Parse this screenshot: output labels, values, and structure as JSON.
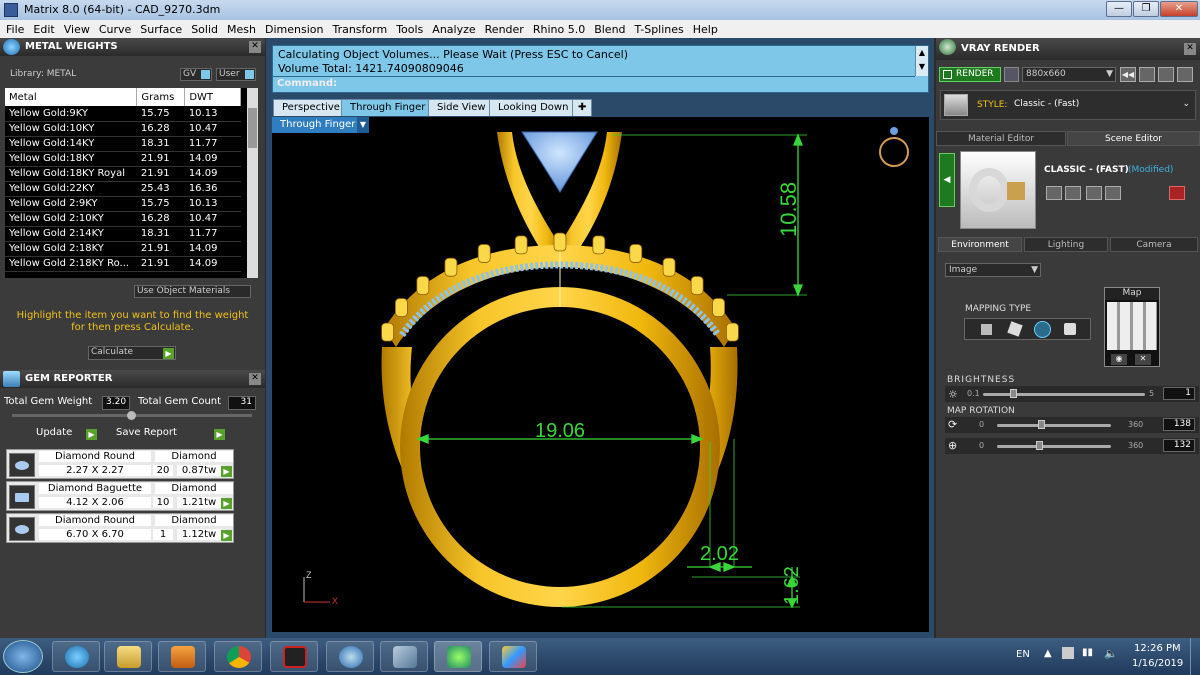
{
  "window": {
    "title": "Matrix 8.0 (64-bit) - CAD_9270.3dm"
  },
  "menu": [
    "File",
    "Edit",
    "View",
    "Curve",
    "Surface",
    "Solid",
    "Mesh",
    "Dimension",
    "Transform",
    "Tools",
    "Analyze",
    "Render",
    "Rhino 5.0",
    "Blend",
    "T-Splines",
    "Help"
  ],
  "metal_weights": {
    "title": "METAL WEIGHTS",
    "library_label": "Library: METAL",
    "gv_label": "GV",
    "user_label": "User",
    "columns": [
      "Metal",
      "Grams",
      "DWT"
    ],
    "rows": [
      [
        "Yellow Gold:9KY",
        "15.75",
        "10.13"
      ],
      [
        "Yellow Gold:10KY",
        "16.28",
        "10.47"
      ],
      [
        "Yellow Gold:14KY",
        "18.31",
        "11.77"
      ],
      [
        "Yellow Gold:18KY",
        "21.91",
        "14.09"
      ],
      [
        "Yellow Gold:18KY Royal",
        "21.91",
        "14.09"
      ],
      [
        "Yellow Gold:22KY",
        "25.43",
        "16.36"
      ],
      [
        "Yellow Gold 2:9KY",
        "15.75",
        "10.13"
      ],
      [
        "Yellow Gold 2:10KY",
        "16.28",
        "10.47"
      ],
      [
        "Yellow Gold 2:14KY",
        "18.31",
        "11.77"
      ],
      [
        "Yellow Gold 2:18KY",
        "21.91",
        "14.09"
      ],
      [
        "Yellow Gold 2:18KY Ro...",
        "21.91",
        "14.09"
      ]
    ],
    "use_object_materials": "Use Object Materials",
    "hint": "Highlight the item you want to find the weight for then press Calculate.",
    "calculate_label": "Calculate"
  },
  "gem_reporter": {
    "title": "GEM REPORTER",
    "total_weight_label": "Total Gem Weight",
    "total_weight": "3.20",
    "total_count_label": "Total Gem Count",
    "total_count": "31",
    "update_label": "Update",
    "save_label": "Save Report",
    "gems": [
      {
        "name": "Diamond Round",
        "material": "Diamond",
        "size": "2.27 X 2.27",
        "count": "20",
        "weight": "0.87tw"
      },
      {
        "name": "Diamond Baguette",
        "material": "Diamond",
        "size": "4.12 X 2.06",
        "count": "10",
        "weight": "1.21tw"
      },
      {
        "name": "Diamond Round",
        "material": "Diamond",
        "size": "6.70 X 6.70",
        "count": "1",
        "weight": "1.12tw"
      }
    ]
  },
  "command": {
    "line1": "Calculating Object Volumes... Please Wait (Press ESC to Cancel)",
    "line2": "Volume Total: 1421.74090809046",
    "prompt": "Command:"
  },
  "view_tabs": [
    "Perspective",
    "Through Finger",
    "Side View",
    "Looking Down"
  ],
  "active_view": "Through Finger",
  "dimensions": {
    "top_height": "10.58",
    "inner_diameter": "19.06",
    "band_width": "2.02",
    "bottom_thickness": "1.62"
  },
  "axes": {
    "z": "Z",
    "x": "X"
  },
  "vray": {
    "title": "VRAY RENDER",
    "render_label": "RENDER",
    "resolution": "880x660",
    "style_label": "STYLE:",
    "style_value": "Classic - (Fast)",
    "tabs": [
      "Material Editor",
      "Scene Editor"
    ],
    "preset_name": "CLASSIC - (FAST)",
    "modified": "(Modified)",
    "env_tabs": [
      "Environment",
      "Lighting",
      "Camera"
    ],
    "env_type": "Image",
    "mapping_type_label": "MAPPING TYPE",
    "map_label": "Map",
    "brightness_label": "BRIGHTNESS",
    "brightness_min": "0.1",
    "brightness_max": "5",
    "brightness_value": "1",
    "map_rotation_label": "MAP ROTATION",
    "rot1_min": "0",
    "rot1_max": "360",
    "rot1_value": "138",
    "rot2_min": "0",
    "rot2_max": "360",
    "rot2_value": "132"
  },
  "taskbar": {
    "lang": "EN",
    "time": "12:26 PM",
    "date": "1/16/2019"
  },
  "colors": {
    "cmd_bg": "#7ec7e8",
    "gold": "#f2b705",
    "dim_green": "#39d63a",
    "gem_blue": "#8bbfe8"
  }
}
